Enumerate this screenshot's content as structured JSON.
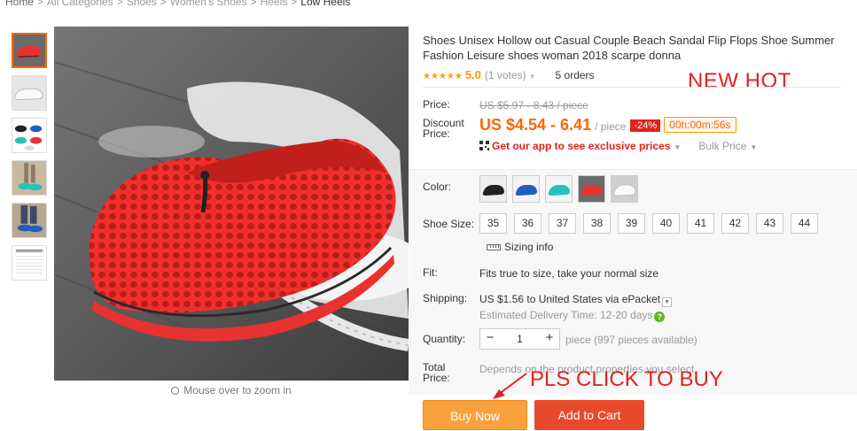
{
  "breadcrumb": [
    "Home",
    "All Categories",
    "Shoes",
    "Women's Shoes",
    "Heels",
    "Low Heels"
  ],
  "breadcrumb_sep": ">",
  "zoom_hint": "Mouse over to zoom in",
  "product": {
    "title": "Shoes Unisex Hollow out Casual Couple Beach Sandal Flip Flops Shoe Summer Fashion Leisure shoes woman 2018 scarpe donna",
    "stars": "★★★★★",
    "rating": "5.0",
    "votes": "(1 votes)",
    "orders": "5 orders"
  },
  "annotations": {
    "new_hot": "NEW HOT",
    "click_to_buy": "PLS CLICK TO BUY"
  },
  "price": {
    "label": "Price:",
    "original": "US $5.97 - 8.43 / piece",
    "discount_label_1": "Discount",
    "discount_label_2": "Price:",
    "discounted": "US $4.54 - 6.41",
    "per": "/ piece",
    "discount_badge": "-24%",
    "timer": "00h:00m:56s",
    "app_prompt": "Get our app to see exclusive prices",
    "bulk": "Bulk Price"
  },
  "options": {
    "color_label": "Color:",
    "colors": [
      "black",
      "blue",
      "aqua",
      "red",
      "white"
    ],
    "size_label": "Shoe Size:",
    "sizes": [
      "35",
      "36",
      "37",
      "38",
      "39",
      "40",
      "41",
      "42",
      "43",
      "44"
    ],
    "sizing_info": "Sizing info",
    "fit_label": "Fit:",
    "fit_value": "Fits true to size, take your normal size",
    "shipping_label": "Shipping:",
    "shipping_value": "US $1.56 to United States via ePacket",
    "delivery": "Estimated Delivery Time: 12-20 days",
    "quantity_label": "Quantity:",
    "quantity_value": "1",
    "quantity_minus": "−",
    "quantity_plus": "+",
    "availability": "piece (997 pieces available)",
    "total_label_1": "Total",
    "total_label_2": "Price:",
    "total_value": "Depends on the product properties you select"
  },
  "buttons": {
    "buy_now": "Buy Now",
    "add_to_cart": "Add to Cart"
  },
  "colors": {
    "accent": "#ff6600",
    "buy_now": "#f9a23d",
    "add_to_cart": "#e8492a",
    "annotation": "#e02222",
    "shoe_red": "#e8322f"
  }
}
